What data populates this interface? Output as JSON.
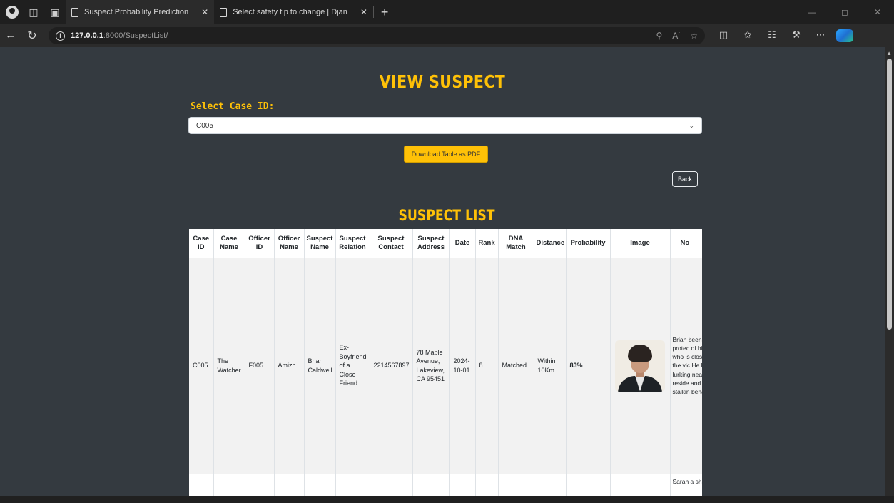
{
  "browser": {
    "tabs": [
      {
        "title": "Suspect Probability Prediction",
        "active": true
      },
      {
        "title": "Select safety tip to change | Djan",
        "active": false
      }
    ],
    "url": {
      "host": "127.0.0.1",
      "port": ":8000",
      "path": "/SuspectList/"
    }
  },
  "page": {
    "title": "VIEW SUSPECT",
    "select_label": "Select Case ID:",
    "selected_case": "C005",
    "download_button": "Download Table as PDF",
    "back_button": "Back",
    "list_title": "SUSPECT LIST"
  },
  "table": {
    "headers": [
      "Case ID",
      "Case Name",
      "Officer ID",
      "Officer Name",
      "Suspect Name",
      "Suspect Relation",
      "Suspect Contact",
      "Suspect Address",
      "Date",
      "Rank",
      "DNA Match",
      "Distance",
      "Probability",
      "Image",
      "No"
    ],
    "rows": [
      {
        "case_id": "C005",
        "case_name": "The Watcher",
        "officer_id": "F005",
        "officer_name": "Amizh",
        "suspect_name": "Brian Caldwell",
        "relation": "Ex-Boyfriend of a Close Friend",
        "contact": "2214567897",
        "address": "78 Maple Avenue, Lakeview, CA 95451",
        "date": "2024-10-01",
        "rank": "8",
        "dna_match": "Matched",
        "distance": "Within 10Km",
        "probability": "83%",
        "image": "suspect-photo",
        "notes": "Brian been obsess protec of his girlfrie who is close friend the vic He has been lurking near t victim reside and ha history stalkin behavi"
      },
      {
        "notes": "Sarah a shor"
      }
    ]
  }
}
